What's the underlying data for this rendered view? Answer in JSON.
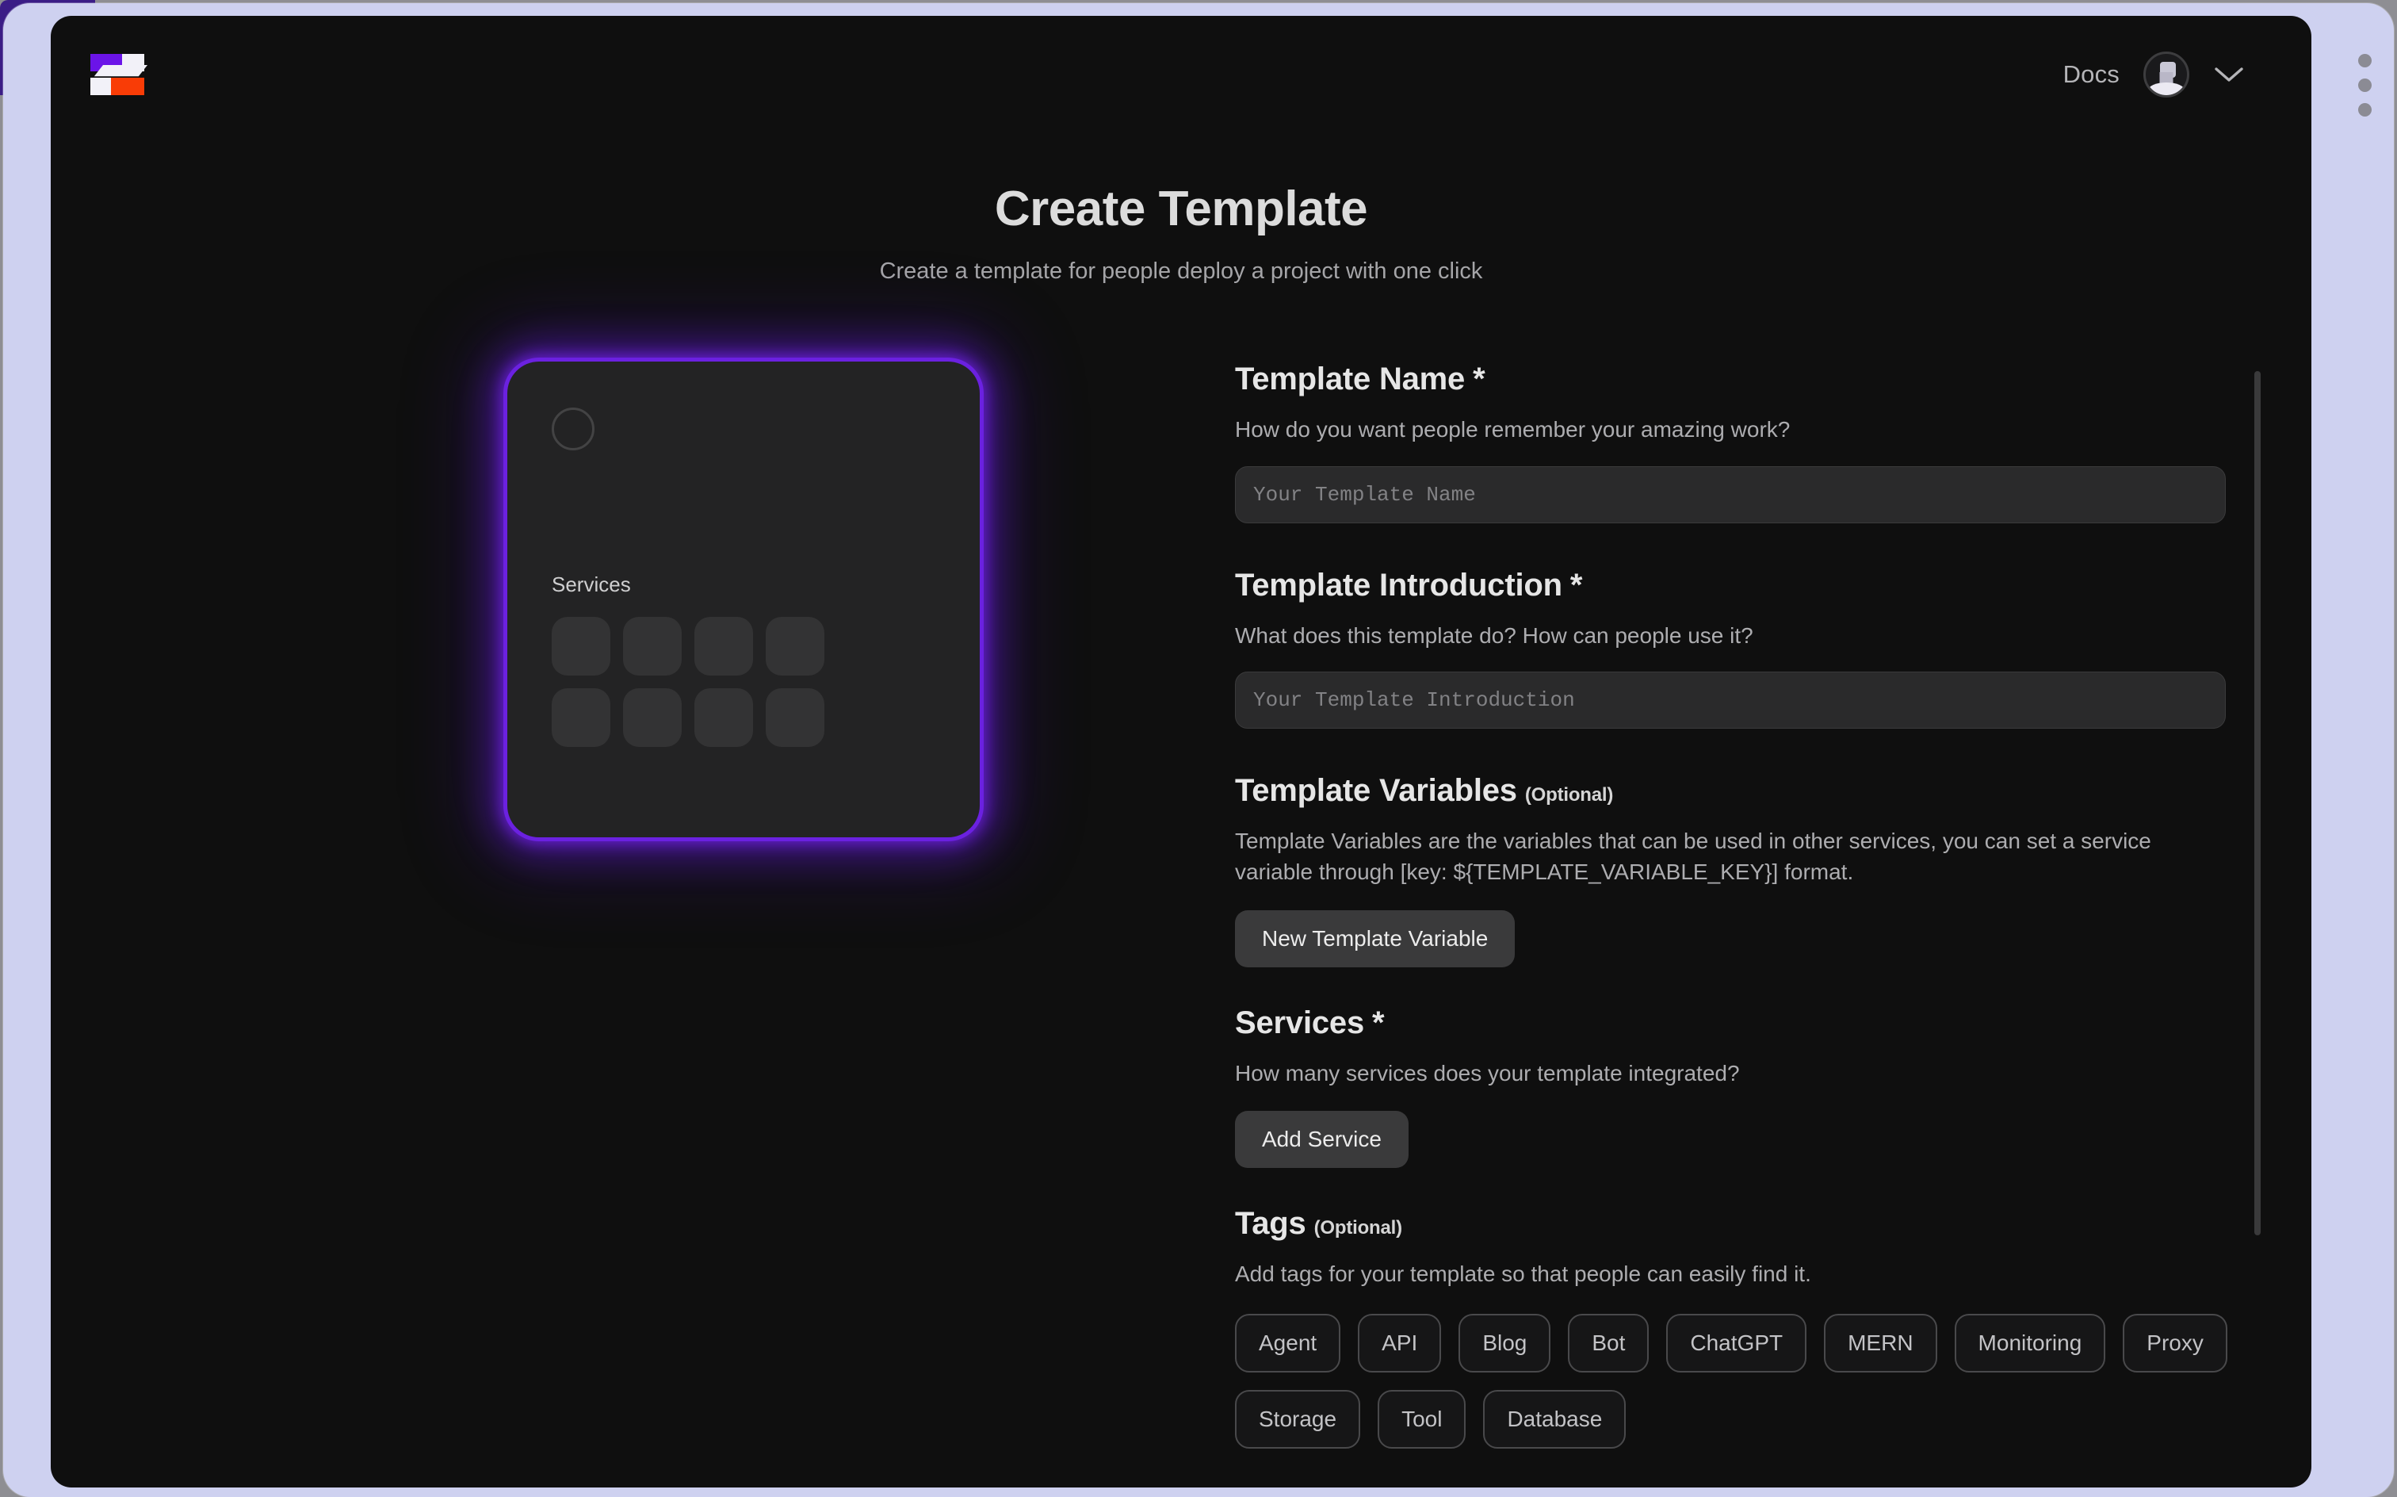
{
  "window": {
    "handle_icon": "drag-handle-dots-icon"
  },
  "header": {
    "logo_name": "sealos-logo",
    "docs_label": "Docs",
    "avatar_name": "user-avatar",
    "chevron_name": "chevron-down-icon"
  },
  "page": {
    "title": "Create Template",
    "subtitle": "Create a template for people deploy a project with one click"
  },
  "preview": {
    "services_label": "Services",
    "logo_placeholder": "template-logo-placeholder",
    "slot_count": 8
  },
  "form": {
    "template_name": {
      "title": "Template Name",
      "required_mark": "*",
      "description": "How do you want people remember your amazing work?",
      "placeholder": "Your Template Name",
      "value": ""
    },
    "template_introduction": {
      "title": "Template Introduction",
      "required_mark": "*",
      "description": "What does this template do? How can people use it?",
      "placeholder": "Your Template Introduction",
      "value": ""
    },
    "template_variables": {
      "title": "Template Variables",
      "optional_mark": "(Optional)",
      "description": "Template Variables are the variables that can be used in other services, you can set a service variable through [key: ${TEMPLATE_VARIABLE_KEY}] format.",
      "button_label": "New Template Variable"
    },
    "services": {
      "title": "Services",
      "required_mark": "*",
      "description": "How many services does your template integrated?",
      "button_label": "Add Service"
    },
    "tags": {
      "title": "Tags",
      "optional_mark": "(Optional)",
      "description": "Add tags for your template so that people can easily find it.",
      "chips": [
        "Agent",
        "API",
        "Blog",
        "Bot",
        "ChatGPT",
        "MERN",
        "Monitoring",
        "Proxy",
        "Storage",
        "Tool",
        "Database"
      ]
    }
  },
  "colors": {
    "accent_purple": "#6b21e0",
    "logo_purple": "#6b14e8",
    "logo_orange": "#f93c06",
    "frame_lavender": "#ced1f0",
    "page_bg": "#0f0f0f"
  }
}
